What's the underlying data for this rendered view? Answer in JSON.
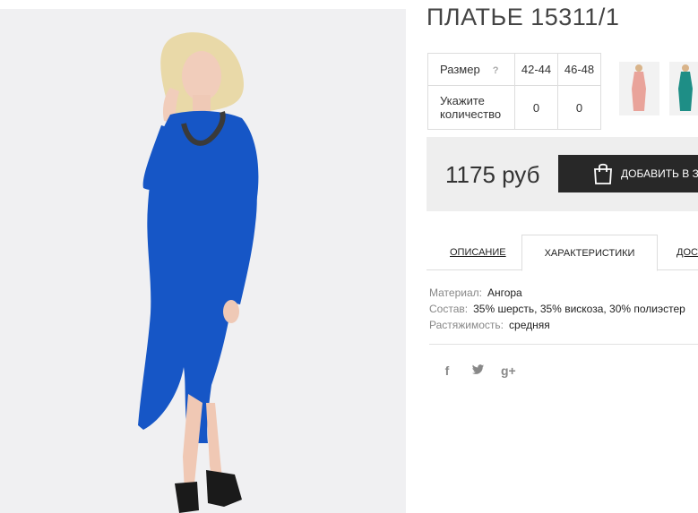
{
  "product": {
    "title": "ПЛАТЬЕ 15311/1"
  },
  "sizes_table": {
    "size_label": "Размер",
    "help": "?",
    "sizes": [
      "42-44",
      "46-48"
    ],
    "qty_label_line1": "Укажите",
    "qty_label_line2": "количество",
    "quantities": [
      "0",
      "0"
    ]
  },
  "thumbnails": [
    {
      "name": "pink-dress-thumbnail",
      "color": "#e9a39a"
    },
    {
      "name": "teal-dress-thumbnail",
      "color": "#1e8e86"
    }
  ],
  "buy": {
    "price": "1175 руб",
    "add_button": "ДОБАВИТЬ В ЗА",
    "cart_icon": "shopping-bag-icon"
  },
  "tabs": {
    "description": "ОПИСАНИЕ",
    "characteristics": "ХАРАКТЕРИСТИКИ",
    "delivery": "ДОСТ"
  },
  "specs": [
    {
      "key": "Материал:",
      "value": "Ангора"
    },
    {
      "key": "Состав:",
      "value": "35% шерсть, 35% вискоза, 30% полиэстер"
    },
    {
      "key": "Растяжимость:",
      "value": "средняя"
    }
  ],
  "social": {
    "facebook": "f",
    "twitter": "twitter-icon",
    "googleplus": "g+"
  },
  "colors": {
    "dress": "#1656c6",
    "button": "#282828",
    "buybox": "#eeeeee"
  }
}
